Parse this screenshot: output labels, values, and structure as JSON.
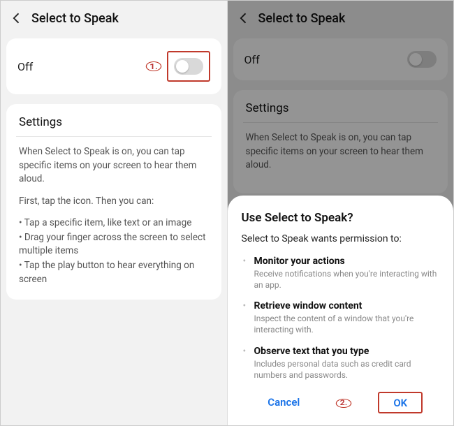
{
  "header": {
    "title": "Select to Speak"
  },
  "state": {
    "label": "Off"
  },
  "steps": {
    "one": "1.",
    "two": "2."
  },
  "settings": {
    "heading": "Settings",
    "para1": "When Select to Speak is on, you can tap specific items on your screen to hear them aloud.",
    "para2": "First, tap the icon. Then you can:",
    "bullets": [
      "Tap a specific item, like text or an image",
      "Drag your finger across the screen to select multiple items",
      "Tap the play button to hear everything on screen"
    ]
  },
  "dialog": {
    "title": "Use Select to Speak?",
    "subtitle": "Select to Speak wants permission to:",
    "permissions": [
      {
        "title": "Monitor your actions",
        "desc": "Receive notifications when you're interacting with an app."
      },
      {
        "title": "Retrieve window content",
        "desc": "Inspect the content of a window that you're interacting with."
      },
      {
        "title": "Observe text that you type",
        "desc": "Includes personal data such as credit card numbers and passwords."
      }
    ],
    "cancel": "Cancel",
    "ok": "OK"
  }
}
